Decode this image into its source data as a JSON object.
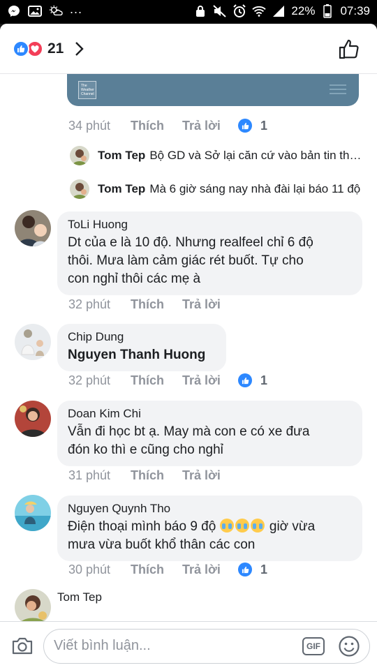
{
  "status_bar": {
    "battery": "22%",
    "time": "07:39",
    "dots": "..."
  },
  "reactions": {
    "count": "21",
    "types": [
      "like-icon",
      "love-icon"
    ]
  },
  "preview": {
    "logo_text": "The Weather Channel"
  },
  "first_actions": {
    "time": "34 phút",
    "like": "Thích",
    "reply": "Trả lời",
    "like_count": "1"
  },
  "replies": [
    {
      "name": "Tom Tep",
      "text": "Bộ GD và Sở lại căn cứ vào bản tin thời..."
    },
    {
      "name": "Tom Tep",
      "text": "Mà 6 giờ sáng nay nhà đài lại báo 11 độ"
    }
  ],
  "comments": [
    {
      "author": "ToLi Huong",
      "lines": [
        "Dt của e là 10 độ. Nhưng realfeel chỉ 6 độ",
        "thôi. Mưa làm cảm giác rét buốt. Tự cho",
        "con nghỉ thôi các mẹ à"
      ],
      "time": "32 phút",
      "like": "Thích",
      "reply": "Trả lời",
      "like_count": ""
    },
    {
      "author": "Chip Dung",
      "lines": [
        "Nguyen Thanh Huong"
      ],
      "time": "32 phút",
      "like": "Thích",
      "reply": "Trả lời",
      "like_count": "1"
    },
    {
      "author": "Doan Kim Chi",
      "lines": [
        "Vẫn đi học bt ạ. May mà con e có xe đưa",
        "đón ko thì e cũng cho nghỉ"
      ],
      "time": "31 phút",
      "like": "Thích",
      "reply": "Trả lời",
      "like_count": ""
    },
    {
      "author": "Nguyen Quynh Tho",
      "line1_before": "Điện thoại mình báo 9 độ ",
      "line1_after": " giờ vừa",
      "line2": "mưa vừa buốt khổ thân các con",
      "emoji": "crying-face-icon",
      "time": "30 phút",
      "like": "Thích",
      "reply": "Trả lời",
      "like_count": "1"
    }
  ],
  "last_comment": {
    "author": "Tom Tep"
  },
  "composer": {
    "placeholder": "Viết bình luận...",
    "gif_label": "GIF"
  },
  "colors": {
    "like_blue": "#2d88ff",
    "love_red": "#f33e58",
    "bubble_gray": "#f2f3f5",
    "meta_gray": "#90949c",
    "preview_blue": "#5a7f97"
  }
}
